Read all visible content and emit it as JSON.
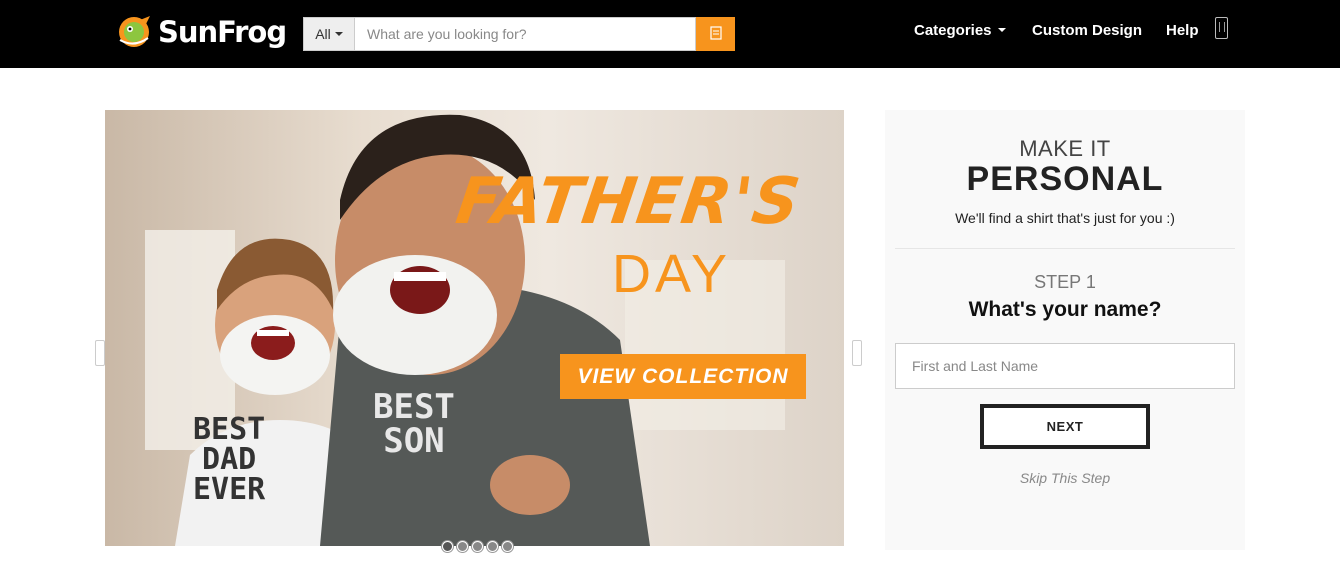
{
  "header": {
    "brand": "SunFrog",
    "search": {
      "category": "All",
      "placeholder": "What are you looking for?"
    },
    "nav": {
      "categories": "Categories",
      "custom_design": "Custom Design",
      "help": "Help"
    },
    "icons": {
      "search": "search-icon",
      "phone": "phone-icon",
      "logo": "frog-logo-icon"
    }
  },
  "hero": {
    "title_line1": "FATHER'S",
    "title_line2": "DAY",
    "cta": "VIEW COLLECTION",
    "kid_shirt": "BEST DAD EVER",
    "dad_shirt": "BEST SON",
    "slide_count": 5,
    "active_slide": 0
  },
  "personalize": {
    "eyebrow": "MAKE IT",
    "title": "PERSONAL",
    "subtitle": "We'll find a shirt that's just for you :)",
    "step": "STEP 1",
    "question": "What's your name?",
    "name_placeholder": "First and Last Name",
    "next": "NEXT",
    "skip": "Skip This Step"
  },
  "colors": {
    "accent": "#f7941d",
    "topbar": "#000000"
  }
}
